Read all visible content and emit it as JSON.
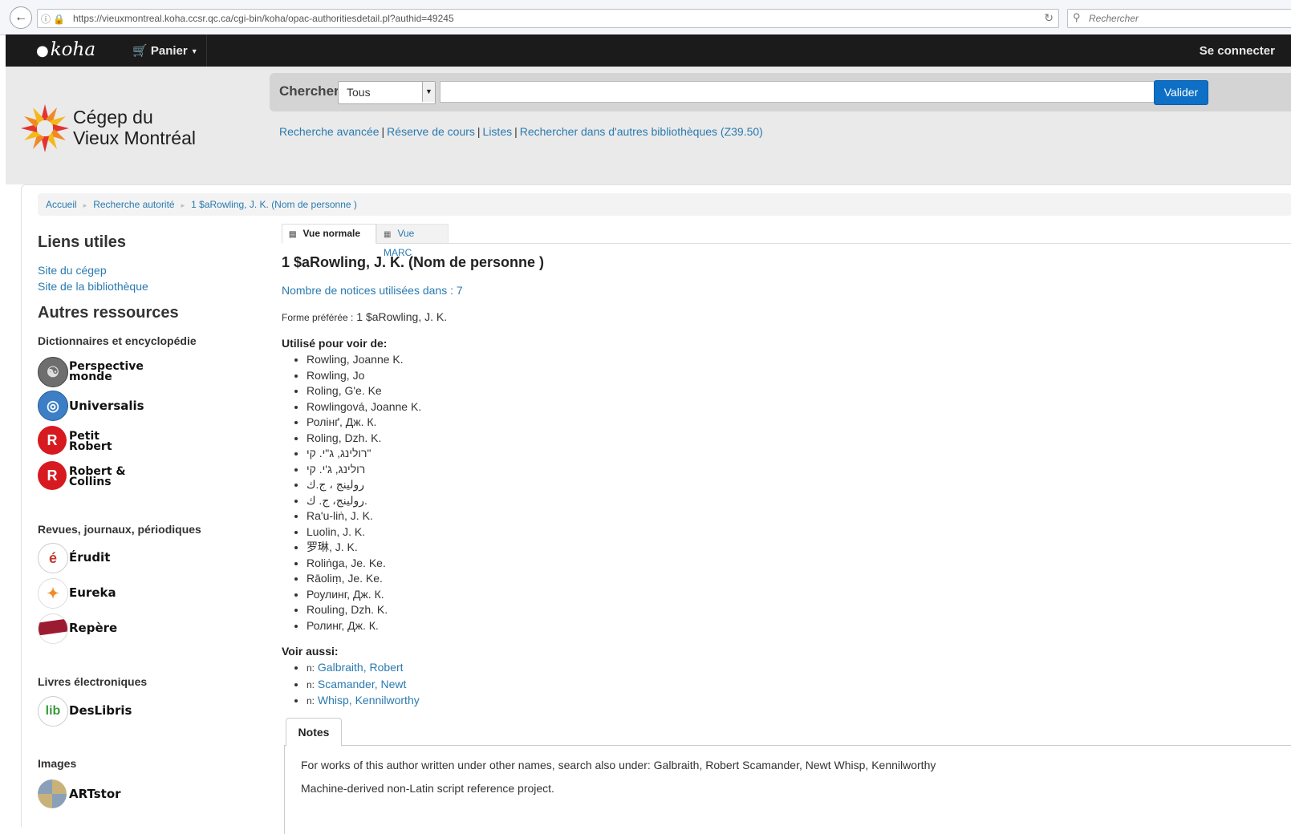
{
  "browser": {
    "url": "https://vieuxmontreal.koha.ccsr.qc.ca/cgi-bin/koha/opac-authoritiesdetail.pl?authid=49245",
    "search_placeholder": "Rechercher"
  },
  "navbar": {
    "logo": "koha",
    "cart_label": "Panier",
    "login_label": "Se connecter"
  },
  "header": {
    "institution_line1": "Cégep du",
    "institution_line2": "Vieux Montréal",
    "search_label": "Chercher",
    "search_scope": "Tous",
    "search_button": "Valider",
    "links": [
      "Recherche avancée",
      "Réserve de cours",
      "Listes",
      "Rechercher dans d'autres bibliothèques (Z39.50)"
    ]
  },
  "breadcrumb": [
    "Accueil",
    "Recherche autorité",
    "1 $aRowling, J. K. (Nom de personne )"
  ],
  "sidebar": {
    "useful_links_title": "Liens utiles",
    "useful_links": [
      "Site du cégep",
      "Site de la bibliothèque"
    ],
    "other_resources_title": "Autres ressources",
    "groups": [
      {
        "title": "Dictionnaires et encyclopédie",
        "items": [
          {
            "label_line1": "Perspective",
            "label_line2": "monde",
            "icon": "globe-icon"
          },
          {
            "label_line1": "Universalis",
            "label_line2": "",
            "icon": "universalis-icon"
          },
          {
            "label_line1": "Petit",
            "label_line2": "Robert",
            "icon": "robert-icon"
          },
          {
            "label_line1": "Robert &",
            "label_line2": "Collins",
            "icon": "robert-icon"
          }
        ]
      },
      {
        "title": "Revues, journaux, périodiques",
        "items": [
          {
            "label_line1": "Érudit",
            "label_line2": "",
            "icon": "erudit-icon"
          },
          {
            "label_line1": "Eureka",
            "label_line2": "",
            "icon": "fish-icon"
          },
          {
            "label_line1": "Repère",
            "label_line2": "",
            "icon": "repere-icon"
          }
        ]
      },
      {
        "title": "Livres électroniques",
        "items": [
          {
            "label_line1": "DesLibris",
            "label_line2": "",
            "icon": "deslibris-icon"
          }
        ]
      },
      {
        "title": "Images",
        "items": [
          {
            "label_line1": "ARTstor",
            "label_line2": "",
            "icon": "artstor-icon"
          }
        ]
      }
    ]
  },
  "tabs": {
    "normal": "Vue normale",
    "marc": "Vue MARC"
  },
  "record": {
    "title": "1 $aRowling, J. K. (Nom de personne )",
    "usage": "Nombre de notices utilisées dans : 7",
    "preferred_label": "Forme préférée :",
    "preferred_value": "1 $aRowling, J. K.",
    "see_from_title": "Utilisé pour voir de:",
    "see_from": [
      "Rowling, Joanne K.",
      "Rowling, Jo",
      "Roling, G'e. Ke",
      "Rowlingová, Joanne K.",
      "Ролінґ, Дж. К.",
      "Roling, Dzh. K.",
      "רולינג, ג\"י. קי\"",
      "רולינג, ג'י. קי",
      "رولينج ، ج.ك",
      "رولينج، ج. ك.",
      "Ra'u-liṅ, J. K.",
      "Luolin, J. K.",
      "罗琳, J. K.",
      "Roliṅga, Je. Ke.",
      "Rāoliṃ, Je. Ke.",
      "Роулинг, Дж. К.",
      "Rouling, Dzh. K.",
      "Ролинг, Дж. К."
    ],
    "see_also_title": "Voir aussi:",
    "see_also_prefix": "n:",
    "see_also": [
      "Galbraith, Robert",
      "Scamander, Newt",
      "Whisp, Kennilworthy"
    ],
    "notes_tab": "Notes",
    "notes": [
      "For works of this author written under other names, search also under: Galbraith, Robert Scamander, Newt Whisp, Kennilworthy",
      "Machine-derived non-Latin script reference project."
    ]
  },
  "colors": {
    "link": "#2a7ab0",
    "navbar": "#1b1b1b",
    "header_bg": "#eaeaea",
    "button": "#0d6fc6"
  }
}
